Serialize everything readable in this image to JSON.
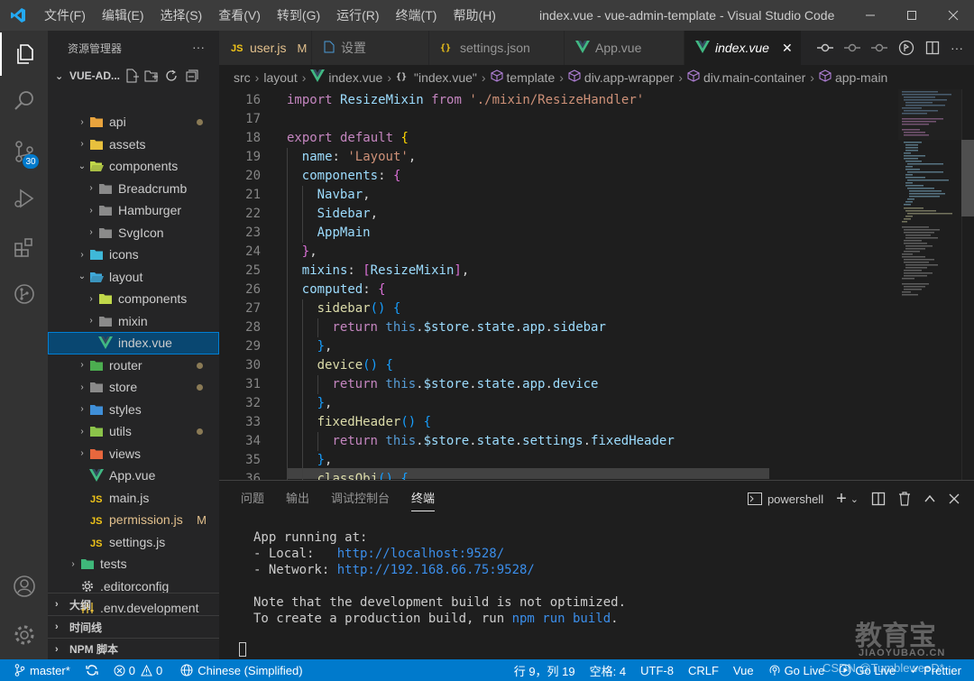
{
  "titlebar": {
    "menu": [
      "文件(F)",
      "编辑(E)",
      "选择(S)",
      "查看(V)",
      "转到(G)",
      "运行(R)",
      "终端(T)",
      "帮助(H)"
    ],
    "title": "index.vue - vue-admin-template - Visual Studio Code"
  },
  "activity": {
    "scm_badge": "30"
  },
  "sidebar": {
    "header": "资源管理器",
    "more": "···",
    "root": "VUE-AD...",
    "tree": [
      {
        "label": "api",
        "icon": "folder-icon",
        "color": "#e8a33d",
        "chev": "›",
        "indent": 0,
        "dot": true
      },
      {
        "label": "assets",
        "icon": "folder-icon",
        "color": "#e8c03d",
        "chev": "›",
        "indent": 0
      },
      {
        "label": "components",
        "icon": "folder-open-icon",
        "color": "#c0d84a",
        "chev": "⌄",
        "indent": 0
      },
      {
        "label": "Breadcrumb",
        "icon": "folder-icon",
        "color": "#8a8a8a",
        "chev": "›",
        "indent": 1
      },
      {
        "label": "Hamburger",
        "icon": "folder-icon",
        "color": "#8a8a8a",
        "chev": "›",
        "indent": 1
      },
      {
        "label": "SvgIcon",
        "icon": "folder-icon",
        "color": "#8a8a8a",
        "chev": "›",
        "indent": 1
      },
      {
        "label": "icons",
        "icon": "folder-icon",
        "color": "#3fb8d8",
        "chev": "›",
        "indent": 0
      },
      {
        "label": "layout",
        "icon": "folder-open-icon",
        "color": "#3fa8d8",
        "chev": "⌄",
        "indent": 0
      },
      {
        "label": "components",
        "icon": "folder-icon",
        "color": "#c0d84a",
        "chev": "›",
        "indent": 1
      },
      {
        "label": "mixin",
        "icon": "folder-icon",
        "color": "#8a8a8a",
        "chev": "›",
        "indent": 1
      },
      {
        "label": "index.vue",
        "icon": "vue-icon",
        "color": "#41b883",
        "chev": "",
        "indent": 1,
        "selected": true
      },
      {
        "label": "router",
        "icon": "folder-icon",
        "color": "#4cae50",
        "chev": "›",
        "indent": 0,
        "dot": true
      },
      {
        "label": "store",
        "icon": "folder-icon",
        "color": "#8a8a8a",
        "chev": "›",
        "indent": 0,
        "dot": true
      },
      {
        "label": "styles",
        "icon": "folder-icon",
        "color": "#3f8fd8",
        "chev": "›",
        "indent": 0
      },
      {
        "label": "utils",
        "icon": "folder-icon",
        "color": "#8bc34a",
        "chev": "›",
        "indent": 0,
        "dot": true
      },
      {
        "label": "views",
        "icon": "folder-icon",
        "color": "#e8673d",
        "chev": "›",
        "indent": 0
      },
      {
        "label": "App.vue",
        "icon": "vue-icon",
        "color": "#41b883",
        "chev": "",
        "indent": 0
      },
      {
        "label": "main.js",
        "icon": "js-icon",
        "color": "#f0c419",
        "chev": "",
        "indent": 0
      },
      {
        "label": "permission.js",
        "icon": "js-icon",
        "color": "#f0c419",
        "chev": "",
        "indent": 0,
        "modified": true,
        "mark": "M"
      },
      {
        "label": "settings.js",
        "icon": "js-icon",
        "color": "#f0c419",
        "chev": "",
        "indent": 0
      },
      {
        "label": "tests",
        "icon": "folder-icon",
        "color": "#3fb87a",
        "chev": "›",
        "indent": -1
      },
      {
        "label": ".editorconfig",
        "icon": "gear-icon",
        "color": "#cccccc",
        "chev": "",
        "indent": -1
      },
      {
        "label": ".env.development",
        "icon": "settings-file-icon",
        "color": "#e8c03d",
        "chev": "",
        "indent": -1
      }
    ],
    "sections": [
      "大纲",
      "时间线",
      "NPM 脚本"
    ]
  },
  "tabs": [
    {
      "label": "user.js",
      "icon": "js-icon",
      "modified": true,
      "mark": "M"
    },
    {
      "label": "设置",
      "icon": "file-icon"
    },
    {
      "label": "settings.json",
      "icon": "json-icon"
    },
    {
      "label": "App.vue",
      "icon": "vue-icon"
    },
    {
      "label": "index.vue",
      "icon": "vue-icon",
      "active": true,
      "close": "✕"
    }
  ],
  "breadcrumb": [
    "src",
    "layout",
    "index.vue",
    "\"index.vue\"",
    "template",
    "div.app-wrapper",
    "div.main-container",
    "app-main"
  ],
  "editor": {
    "lines": [
      {
        "n": "16",
        "indent": 0,
        "tokens": [
          [
            "kw",
            "import "
          ],
          [
            "prop",
            "ResizeMixin "
          ],
          [
            "kw",
            "from "
          ],
          [
            "str",
            "'./mixin/ResizeHandler'"
          ]
        ]
      },
      {
        "n": "17",
        "indent": 0,
        "tokens": []
      },
      {
        "n": "18",
        "indent": 0,
        "tokens": [
          [
            "kw",
            "export default "
          ],
          [
            "br1",
            "{"
          ]
        ]
      },
      {
        "n": "19",
        "indent": 1,
        "tokens": [
          [
            "prop",
            "name"
          ],
          [
            "",
            ": "
          ],
          [
            "str",
            "'Layout'"
          ],
          [
            "",
            ","
          ]
        ]
      },
      {
        "n": "20",
        "indent": 1,
        "tokens": [
          [
            "prop",
            "components"
          ],
          [
            "",
            ": "
          ],
          [
            "br2",
            "{"
          ]
        ]
      },
      {
        "n": "21",
        "indent": 2,
        "tokens": [
          [
            "prop",
            "Navbar"
          ],
          [
            "",
            ","
          ]
        ]
      },
      {
        "n": "22",
        "indent": 2,
        "tokens": [
          [
            "prop",
            "Sidebar"
          ],
          [
            "",
            ","
          ]
        ]
      },
      {
        "n": "23",
        "indent": 2,
        "tokens": [
          [
            "prop",
            "AppMain"
          ]
        ]
      },
      {
        "n": "24",
        "indent": 1,
        "tokens": [
          [
            "br2",
            "}"
          ],
          [
            "",
            ","
          ]
        ]
      },
      {
        "n": "25",
        "indent": 1,
        "tokens": [
          [
            "prop",
            "mixins"
          ],
          [
            "",
            ": "
          ],
          [
            "br2",
            "["
          ],
          [
            "prop",
            "ResizeMixin"
          ],
          [
            "br2",
            "]"
          ],
          [
            "",
            ","
          ]
        ]
      },
      {
        "n": "26",
        "indent": 1,
        "tokens": [
          [
            "prop",
            "computed"
          ],
          [
            "",
            ": "
          ],
          [
            "br2",
            "{"
          ]
        ]
      },
      {
        "n": "27",
        "indent": 2,
        "tokens": [
          [
            "fn",
            "sidebar"
          ],
          [
            "br3",
            "()"
          ],
          [
            "",
            " "
          ],
          [
            "br3",
            "{"
          ]
        ]
      },
      {
        "n": "28",
        "indent": 3,
        "tokens": [
          [
            "kw",
            "return "
          ],
          [
            "kw2",
            "this"
          ],
          [
            "",
            "."
          ],
          [
            "prop",
            "$store"
          ],
          [
            "",
            "."
          ],
          [
            "prop",
            "state"
          ],
          [
            "",
            "."
          ],
          [
            "prop",
            "app"
          ],
          [
            "",
            "."
          ],
          [
            "prop",
            "sidebar"
          ]
        ]
      },
      {
        "n": "29",
        "indent": 2,
        "tokens": [
          [
            "br3",
            "}"
          ],
          [
            "",
            ","
          ]
        ]
      },
      {
        "n": "30",
        "indent": 2,
        "tokens": [
          [
            "fn",
            "device"
          ],
          [
            "br3",
            "()"
          ],
          [
            "",
            " "
          ],
          [
            "br3",
            "{"
          ]
        ]
      },
      {
        "n": "31",
        "indent": 3,
        "tokens": [
          [
            "kw",
            "return "
          ],
          [
            "kw2",
            "this"
          ],
          [
            "",
            "."
          ],
          [
            "prop",
            "$store"
          ],
          [
            "",
            "."
          ],
          [
            "prop",
            "state"
          ],
          [
            "",
            "."
          ],
          [
            "prop",
            "app"
          ],
          [
            "",
            "."
          ],
          [
            "prop",
            "device"
          ]
        ]
      },
      {
        "n": "32",
        "indent": 2,
        "tokens": [
          [
            "br3",
            "}"
          ],
          [
            "",
            ","
          ]
        ]
      },
      {
        "n": "33",
        "indent": 2,
        "tokens": [
          [
            "fn",
            "fixedHeader"
          ],
          [
            "br3",
            "()"
          ],
          [
            "",
            " "
          ],
          [
            "br3",
            "{"
          ]
        ]
      },
      {
        "n": "34",
        "indent": 3,
        "tokens": [
          [
            "kw",
            "return "
          ],
          [
            "kw2",
            "this"
          ],
          [
            "",
            "."
          ],
          [
            "prop",
            "$store"
          ],
          [
            "",
            "."
          ],
          [
            "prop",
            "state"
          ],
          [
            "",
            "."
          ],
          [
            "prop",
            "settings"
          ],
          [
            "",
            "."
          ],
          [
            "prop",
            "fixedHeader"
          ]
        ]
      },
      {
        "n": "35",
        "indent": 2,
        "tokens": [
          [
            "br3",
            "}"
          ],
          [
            "",
            ","
          ]
        ]
      },
      {
        "n": "36",
        "indent": 2,
        "tokens": [
          [
            "fn",
            "classObj"
          ],
          [
            "br3",
            "()"
          ],
          [
            "",
            " "
          ],
          [
            "br3",
            "{"
          ]
        ]
      }
    ]
  },
  "panel": {
    "tabs": [
      "问题",
      "输出",
      "调试控制台",
      "终端"
    ],
    "active_tab": 3,
    "shell": "powershell",
    "terminal": {
      "l1": "App running at:",
      "l2a": "- Local:   ",
      "l2b": "http://localhost:9528/",
      "l3a": "- Network: ",
      "l3b": "http://192.168.66.75:9528/",
      "l4": "Note that the development build is not optimized.",
      "l5a": "To create a production build, run ",
      "l5b": "npm run build",
      "l5c": "."
    }
  },
  "watermark": {
    "main": "教育宝",
    "sub": "JIAOYUBAO.CN",
    "csdn": "CSDN @TumbleweeD*"
  },
  "statusbar": {
    "branch": "master*",
    "errors": "0",
    "warnings": "0",
    "language_pack": "Chinese (Simplified)",
    "position": "行 9，列 19",
    "spaces": "空格: 4",
    "encoding": "UTF-8",
    "eol": "CRLF",
    "mode": "Vue",
    "golive1": "Go Live",
    "golive2": "Go Live",
    "prettier": "Prettier"
  }
}
